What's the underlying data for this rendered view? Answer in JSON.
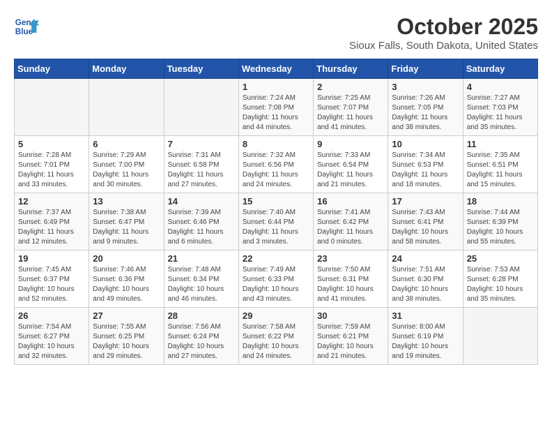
{
  "header": {
    "logo_line1": "General",
    "logo_line2": "Blue",
    "title": "October 2025",
    "subtitle": "Sioux Falls, South Dakota, United States"
  },
  "days_of_week": [
    "Sunday",
    "Monday",
    "Tuesday",
    "Wednesday",
    "Thursday",
    "Friday",
    "Saturday"
  ],
  "weeks": [
    [
      {
        "day": "",
        "info": ""
      },
      {
        "day": "",
        "info": ""
      },
      {
        "day": "",
        "info": ""
      },
      {
        "day": "1",
        "info": "Sunrise: 7:24 AM\nSunset: 7:08 PM\nDaylight: 11 hours\nand 44 minutes."
      },
      {
        "day": "2",
        "info": "Sunrise: 7:25 AM\nSunset: 7:07 PM\nDaylight: 11 hours\nand 41 minutes."
      },
      {
        "day": "3",
        "info": "Sunrise: 7:26 AM\nSunset: 7:05 PM\nDaylight: 11 hours\nand 38 minutes."
      },
      {
        "day": "4",
        "info": "Sunrise: 7:27 AM\nSunset: 7:03 PM\nDaylight: 11 hours\nand 35 minutes."
      }
    ],
    [
      {
        "day": "5",
        "info": "Sunrise: 7:28 AM\nSunset: 7:01 PM\nDaylight: 11 hours\nand 33 minutes."
      },
      {
        "day": "6",
        "info": "Sunrise: 7:29 AM\nSunset: 7:00 PM\nDaylight: 11 hours\nand 30 minutes."
      },
      {
        "day": "7",
        "info": "Sunrise: 7:31 AM\nSunset: 6:58 PM\nDaylight: 11 hours\nand 27 minutes."
      },
      {
        "day": "8",
        "info": "Sunrise: 7:32 AM\nSunset: 6:56 PM\nDaylight: 11 hours\nand 24 minutes."
      },
      {
        "day": "9",
        "info": "Sunrise: 7:33 AM\nSunset: 6:54 PM\nDaylight: 11 hours\nand 21 minutes."
      },
      {
        "day": "10",
        "info": "Sunrise: 7:34 AM\nSunset: 6:53 PM\nDaylight: 11 hours\nand 18 minutes."
      },
      {
        "day": "11",
        "info": "Sunrise: 7:35 AM\nSunset: 6:51 PM\nDaylight: 11 hours\nand 15 minutes."
      }
    ],
    [
      {
        "day": "12",
        "info": "Sunrise: 7:37 AM\nSunset: 6:49 PM\nDaylight: 11 hours\nand 12 minutes."
      },
      {
        "day": "13",
        "info": "Sunrise: 7:38 AM\nSunset: 6:47 PM\nDaylight: 11 hours\nand 9 minutes."
      },
      {
        "day": "14",
        "info": "Sunrise: 7:39 AM\nSunset: 6:46 PM\nDaylight: 11 hours\nand 6 minutes."
      },
      {
        "day": "15",
        "info": "Sunrise: 7:40 AM\nSunset: 6:44 PM\nDaylight: 11 hours\nand 3 minutes."
      },
      {
        "day": "16",
        "info": "Sunrise: 7:41 AM\nSunset: 6:42 PM\nDaylight: 11 hours\nand 0 minutes."
      },
      {
        "day": "17",
        "info": "Sunrise: 7:43 AM\nSunset: 6:41 PM\nDaylight: 10 hours\nand 58 minutes."
      },
      {
        "day": "18",
        "info": "Sunrise: 7:44 AM\nSunset: 6:39 PM\nDaylight: 10 hours\nand 55 minutes."
      }
    ],
    [
      {
        "day": "19",
        "info": "Sunrise: 7:45 AM\nSunset: 6:37 PM\nDaylight: 10 hours\nand 52 minutes."
      },
      {
        "day": "20",
        "info": "Sunrise: 7:46 AM\nSunset: 6:36 PM\nDaylight: 10 hours\nand 49 minutes."
      },
      {
        "day": "21",
        "info": "Sunrise: 7:48 AM\nSunset: 6:34 PM\nDaylight: 10 hours\nand 46 minutes."
      },
      {
        "day": "22",
        "info": "Sunrise: 7:49 AM\nSunset: 6:33 PM\nDaylight: 10 hours\nand 43 minutes."
      },
      {
        "day": "23",
        "info": "Sunrise: 7:50 AM\nSunset: 6:31 PM\nDaylight: 10 hours\nand 41 minutes."
      },
      {
        "day": "24",
        "info": "Sunrise: 7:51 AM\nSunset: 6:30 PM\nDaylight: 10 hours\nand 38 minutes."
      },
      {
        "day": "25",
        "info": "Sunrise: 7:53 AM\nSunset: 6:28 PM\nDaylight: 10 hours\nand 35 minutes."
      }
    ],
    [
      {
        "day": "26",
        "info": "Sunrise: 7:54 AM\nSunset: 6:27 PM\nDaylight: 10 hours\nand 32 minutes."
      },
      {
        "day": "27",
        "info": "Sunrise: 7:55 AM\nSunset: 6:25 PM\nDaylight: 10 hours\nand 29 minutes."
      },
      {
        "day": "28",
        "info": "Sunrise: 7:56 AM\nSunset: 6:24 PM\nDaylight: 10 hours\nand 27 minutes."
      },
      {
        "day": "29",
        "info": "Sunrise: 7:58 AM\nSunset: 6:22 PM\nDaylight: 10 hours\nand 24 minutes."
      },
      {
        "day": "30",
        "info": "Sunrise: 7:59 AM\nSunset: 6:21 PM\nDaylight: 10 hours\nand 21 minutes."
      },
      {
        "day": "31",
        "info": "Sunrise: 8:00 AM\nSunset: 6:19 PM\nDaylight: 10 hours\nand 19 minutes."
      },
      {
        "day": "",
        "info": ""
      }
    ]
  ]
}
